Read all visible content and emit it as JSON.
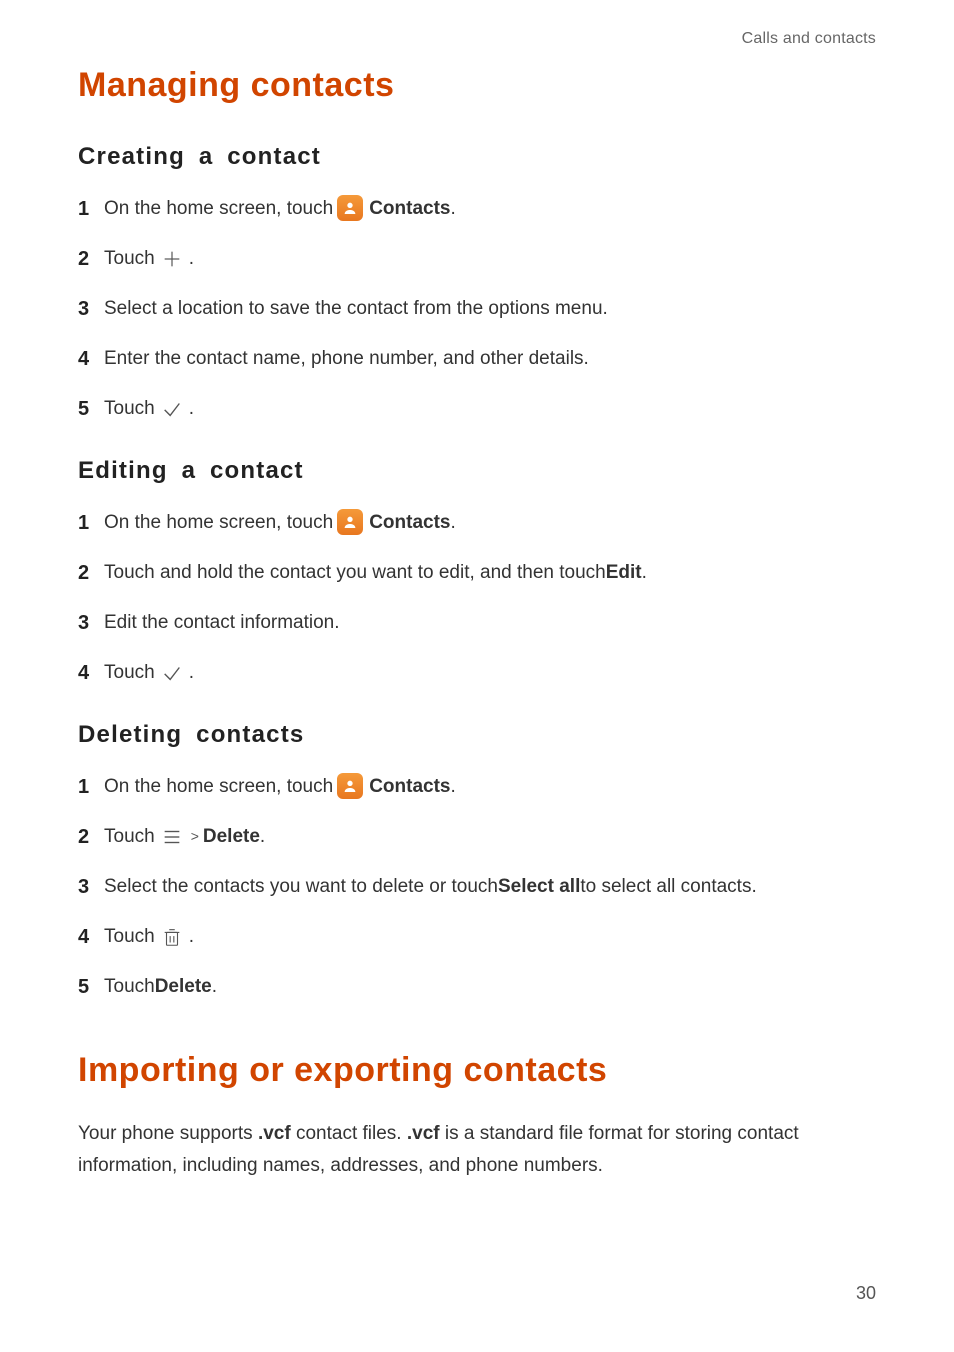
{
  "header": {
    "breadcrumb": "Calls and contacts"
  },
  "section1": {
    "title": "Managing contacts",
    "sub1": {
      "title": "Creating a contact",
      "steps": {
        "s1": {
          "num": "1",
          "pre": "On the home screen, touch ",
          "bold": "Contacts",
          "post": "."
        },
        "s2": {
          "num": "2",
          "pre": "Touch ",
          "post": "."
        },
        "s3": {
          "num": "3",
          "text": "Select a location to save the contact from the options menu."
        },
        "s4": {
          "num": "4",
          "text": "Enter the contact name, phone number, and other details."
        },
        "s5": {
          "num": "5",
          "pre": "Touch ",
          "post": "."
        }
      }
    },
    "sub2": {
      "title": "Editing a contact",
      "steps": {
        "s1": {
          "num": "1",
          "pre": "On the home screen, touch ",
          "bold": "Contacts",
          "post": "."
        },
        "s2": {
          "num": "2",
          "pre": "Touch and hold the contact you want to edit, and then touch ",
          "bold": "Edit",
          "post": "."
        },
        "s3": {
          "num": "3",
          "text": "Edit the contact information."
        },
        "s4": {
          "num": "4",
          "pre": "Touch ",
          "post": "."
        }
      }
    },
    "sub3": {
      "title": "Deleting contacts",
      "steps": {
        "s1": {
          "num": "1",
          "pre": "On the home screen, touch ",
          "bold": "Contacts",
          "post": "."
        },
        "s2": {
          "num": "2",
          "pre": "Touch ",
          "caret": ">",
          "bold": "Delete",
          "post": "."
        },
        "s3": {
          "num": "3",
          "pre": "Select the contacts you want to delete or touch ",
          "bold": "Select all",
          "post": " to select all contacts."
        },
        "s4": {
          "num": "4",
          "pre": "Touch ",
          "post": "."
        },
        "s5": {
          "num": "5",
          "pre": "Touch ",
          "bold": "Delete",
          "post": "."
        }
      }
    }
  },
  "section2": {
    "title": "Importing or exporting contacts",
    "paragraph": {
      "t1": "Your phone supports ",
      "b1": ".vcf",
      "t2": " contact files. ",
      "b2": ".vcf",
      "t3": " is a standard file format for storing contact information, including names, addresses, and phone numbers."
    }
  },
  "footer": {
    "page": "30"
  }
}
